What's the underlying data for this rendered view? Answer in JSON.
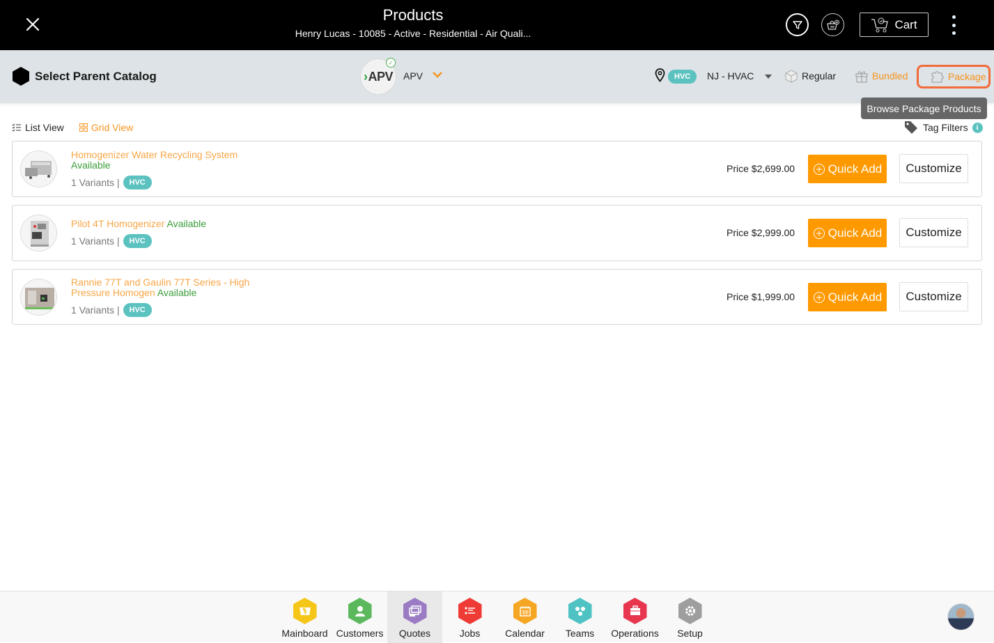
{
  "header": {
    "title": "Products",
    "subtitle": "Henry Lucas - 10085 - Active - Residential - Air Quali...",
    "cart_label": "Cart"
  },
  "subheader": {
    "parent_catalog_label": "Select Parent Catalog",
    "catalog_logo_text": "APV",
    "catalog_name": "APV",
    "location_badge": "HVC",
    "location_name": "NJ - HVAC",
    "product_types": [
      {
        "label": "Regular",
        "active": false
      },
      {
        "label": "Bundled",
        "active": false
      },
      {
        "label": "Package",
        "active": true
      }
    ],
    "tooltip": "Browse Package Products"
  },
  "toolbar": {
    "list_view_label": "List View",
    "grid_view_label": "Grid View",
    "tag_filters_label": "Tag Filters"
  },
  "products": [
    {
      "name": "Homogenizer Water Recycling System",
      "availability": "Available",
      "variants": "1 Variants |",
      "badge": "HVC",
      "price": "Price $2,699.00",
      "quick_add_label": "Quick Add",
      "customize_label": "Customize"
    },
    {
      "name": "Pilot 4T Homogenizer",
      "availability": "Available",
      "variants": "1 Variants |",
      "badge": "HVC",
      "price": "Price $2,999.00",
      "quick_add_label": "Quick Add",
      "customize_label": "Customize"
    },
    {
      "name": "Rannie 77T and Gaulin 77T Series - High Pressure Homogen",
      "availability": "Available",
      "variants": "1 Variants |",
      "badge": "HVC",
      "price": "Price $1,999.00",
      "quick_add_label": "Quick Add",
      "customize_label": "Customize"
    }
  ],
  "bottom_nav": [
    {
      "label": "Mainboard",
      "color": "#f5c518",
      "icon": "mainboard-icon",
      "active": false
    },
    {
      "label": "Customers",
      "color": "#5cb85c",
      "icon": "customer-icon",
      "active": false
    },
    {
      "label": "Quotes",
      "color": "#9b7cc4",
      "icon": "quotes-icon",
      "active": true
    },
    {
      "label": "Jobs",
      "color": "#ef3b36",
      "icon": "jobs-icon",
      "active": false
    },
    {
      "label": "Calendar",
      "color": "#f5a623",
      "icon": "calendar-icon",
      "active": false
    },
    {
      "label": "Teams",
      "color": "#4fc3c3",
      "icon": "teams-icon",
      "active": false
    },
    {
      "label": "Operations",
      "color": "#e8364f",
      "icon": "operations-icon",
      "active": false
    },
    {
      "label": "Setup",
      "color": "#9e9e9e",
      "icon": "setup-icon",
      "active": false
    }
  ],
  "colors": {
    "accent_orange": "#ff9900",
    "product_name": "#f7a646",
    "available_green": "#3a9d3a",
    "badge_teal": "#5bc2c0",
    "package_highlight": "#f26b3a"
  }
}
